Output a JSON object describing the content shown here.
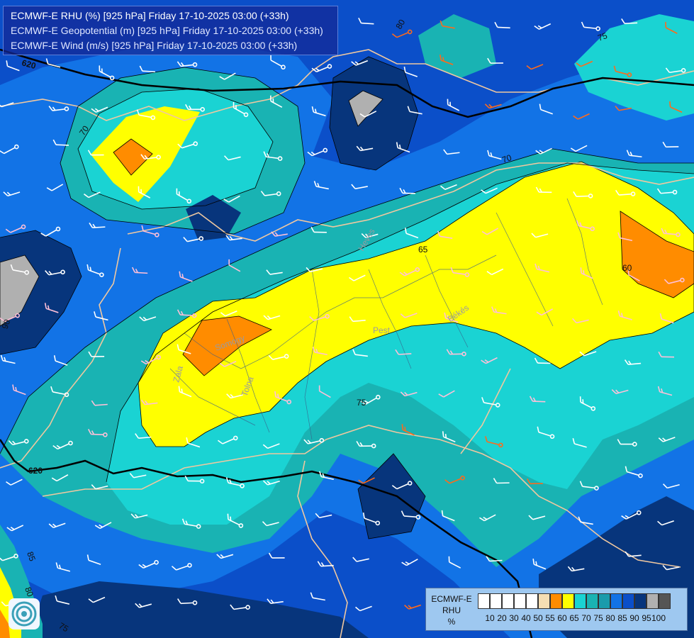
{
  "titles": {
    "line1": "ECMWF-E RHU (%) [925 hPa] Friday 17-10-2025 03:00 (+33h)",
    "line2": "ECMWF-E Geopotential (m) [925 hPa] Friday 17-10-2025 03:00 (+33h)",
    "line3": "ECMWF-E Wind (m/s) [925 hPa] Friday 17-10-2025 03:00 (+33h)"
  },
  "legend": {
    "title_line1": "ECMWF-E",
    "title_line2": "RHU",
    "unit": "%",
    "ticks": [
      "10",
      "20",
      "30",
      "40",
      "50",
      "55",
      "60",
      "65",
      "70",
      "75",
      "80",
      "85",
      "90",
      "95",
      "100"
    ],
    "colors": [
      "#ffffff",
      "#ffffff",
      "#ffffff",
      "#ffffff",
      "#ffffff",
      "#f5deb3",
      "#ff8c00",
      "#ffff00",
      "#1ad3d3",
      "#19b3b3",
      "#1a9bab",
      "#1273e6",
      "#0b4fc9",
      "#07357c",
      "#b0b0b0",
      "#555555"
    ]
  },
  "geopotential_labels": [
    "620",
    "620"
  ],
  "rhu_contour_labels": [
    "70",
    "75",
    "80",
    "60",
    "65",
    "70",
    "75",
    "80",
    "85",
    "90",
    "75",
    "80",
    "60"
  ],
  "place_labels": [
    "Pest",
    "Békés",
    "Tolna",
    "Zala",
    "Somogy",
    "Heves"
  ],
  "colors": {
    "rhu_55_60": "#ff8c00",
    "rhu_60_65": "#ffff00",
    "rhu_65_70": "#1ad3d3",
    "rhu_70_75": "#19b3b3",
    "rhu_75_80": "#1273e6",
    "rhu_80_85": "#0b4fc9",
    "rhu_85_90": "#07357c",
    "rhu_90_95": "#b0b0b0",
    "borders": "#f0c8a0",
    "geopotential_line": "#000000",
    "wind_barb_low": "#ffffff",
    "wind_barb_mid": "#ffc0d8",
    "wind_barb_high": "#ff6a1a"
  },
  "icons": [
    "ecmwf-logo-icon"
  ]
}
